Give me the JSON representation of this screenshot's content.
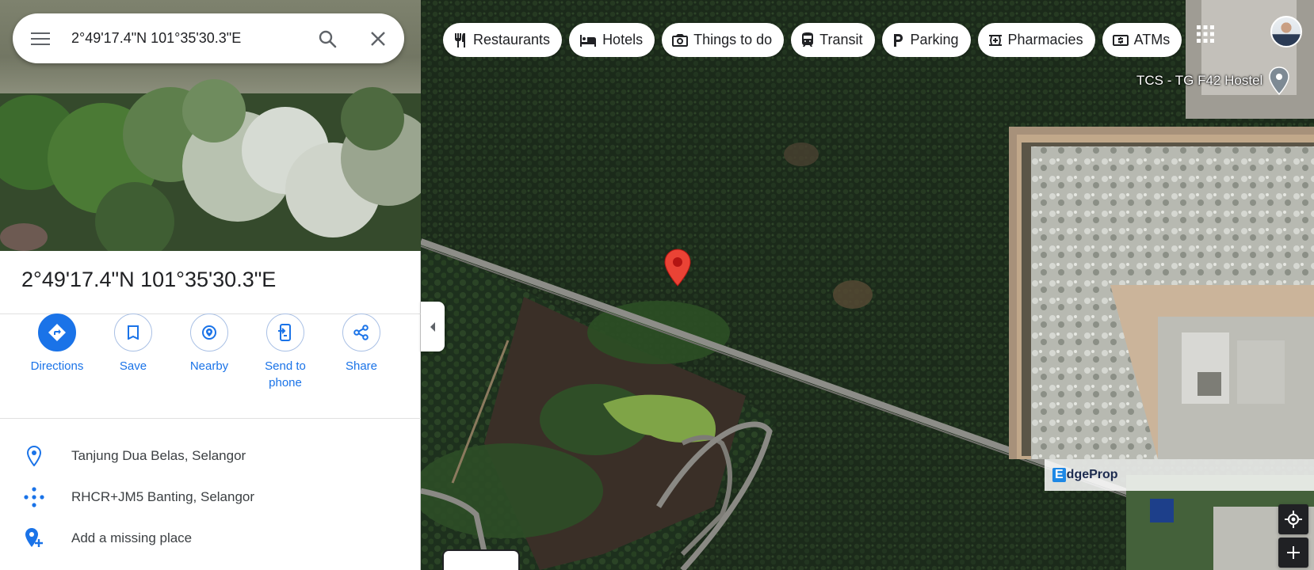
{
  "search": {
    "query": "2°49'17.4\"N 101°35'30.3\"E",
    "menu_icon": "menu-icon",
    "search_icon": "search-icon",
    "close_icon": "close-icon"
  },
  "place": {
    "title": "2°49'17.4\"N 101°35'30.3\"E"
  },
  "actions": [
    {
      "label": "Directions",
      "icon": "directions-icon"
    },
    {
      "label": "Save",
      "icon": "bookmark-icon"
    },
    {
      "label": "Nearby",
      "icon": "nearby-icon"
    },
    {
      "label": "Send to phone",
      "icon": "send-to-phone-icon"
    },
    {
      "label": "Share",
      "icon": "share-icon"
    }
  ],
  "info": [
    {
      "text": "Tanjung Dua Belas, Selangor",
      "icon": "location-pin-icon"
    },
    {
      "text": "RHCR+JM5 Banting, Selangor",
      "icon": "plus-code-icon"
    },
    {
      "text": "Add a missing place",
      "icon": "add-place-icon"
    }
  ],
  "chips": [
    {
      "label": "Restaurants",
      "icon": "restaurant-icon"
    },
    {
      "label": "Hotels",
      "icon": "hotel-icon"
    },
    {
      "label": "Things to do",
      "icon": "camera-icon"
    },
    {
      "label": "Transit",
      "icon": "transit-icon"
    },
    {
      "label": "Parking",
      "icon": "parking-icon"
    },
    {
      "label": "Pharmacies",
      "icon": "pharmacy-icon"
    },
    {
      "label": "ATMs",
      "icon": "atm-icon"
    }
  ],
  "map": {
    "poi_label": "TCS - TG F42 Hostel",
    "watermark": {
      "e": "E",
      "rest": "dgeProp"
    }
  },
  "colors": {
    "accent": "#1a73e8",
    "pin_red": "#ea4335",
    "text": "#202124"
  }
}
